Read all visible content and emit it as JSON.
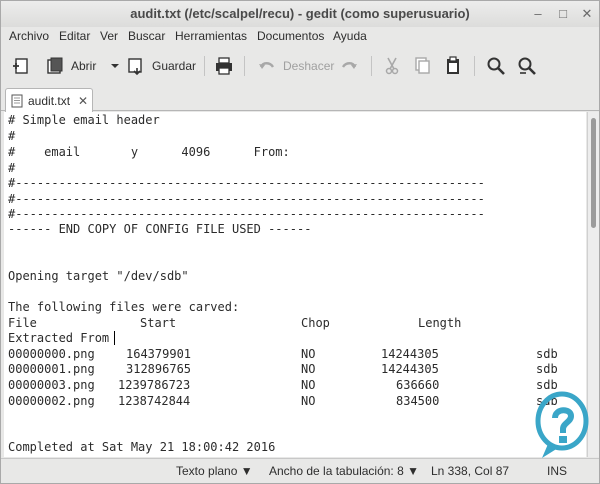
{
  "window": {
    "title": "audit.txt (/etc/scalpel/recu) - gedit (como superusuario)",
    "minimize_glyph": "–",
    "maximize_glyph": "□",
    "close_glyph": "✕"
  },
  "menu": {
    "items": [
      "Archivo",
      "Editar",
      "Ver",
      "Buscar",
      "Herramientas",
      "Documentos",
      "Ayuda"
    ]
  },
  "toolbar": {
    "new_icon": "new-document-icon",
    "open_label": "Abrir",
    "save_label": "Guardar",
    "print_icon": "print-icon",
    "undo_label": "Deshacer",
    "redo_icon": "redo-icon",
    "cut_icon": "cut-icon",
    "copy_icon": "copy-icon",
    "paste_icon": "paste-icon",
    "find_icon": "search-icon",
    "replace_icon": "search-replace-icon"
  },
  "tabs": [
    {
      "label": "audit.txt",
      "close_glyph": "✕"
    }
  ],
  "editor": {
    "lines": [
      "# Simple email header",
      "#",
      "#    email       y      4096      From:",
      "#",
      "#-----------------------------------------------------------------",
      "#-----------------------------------------------------------------",
      "#-----------------------------------------------------------------",
      "------ END COPY OF CONFIG FILE USED ------",
      "",
      "",
      "Opening target \"/dev/sdb\"",
      "",
      "The following files were carved:"
    ],
    "table_header": {
      "file": "File",
      "start": "Start",
      "chop": "Chop",
      "length": "Length",
      "extracted_from": "Extracted From"
    },
    "rows": [
      {
        "file": "00000000.png",
        "start": "164379901",
        "chop": "NO",
        "length": "14244305",
        "from": "sdb"
      },
      {
        "file": "00000001.png",
        "start": "312896765",
        "chop": "NO",
        "length": "14244305",
        "from": "sdb"
      },
      {
        "file": "00000003.png",
        "start": "1239786723",
        "chop": "NO",
        "length": "636660",
        "from": "sdb"
      },
      {
        "file": "00000002.png",
        "start": "1238742844",
        "chop": "NO",
        "length": "834500",
        "from": "sdb"
      }
    ],
    "footer_line": "Completed at Sat May 21 18:00:42 2016"
  },
  "statusbar": {
    "language": "Texto plano",
    "tab_width_label": "Ancho de la tabulación:",
    "tab_width_value": "8",
    "position": "Ln 338, Col 87",
    "mode": "INS"
  },
  "colors": {
    "window_bg": "#e8e8e7",
    "editor_bg": "#ffffff",
    "watermark": "#3aa6c8"
  }
}
